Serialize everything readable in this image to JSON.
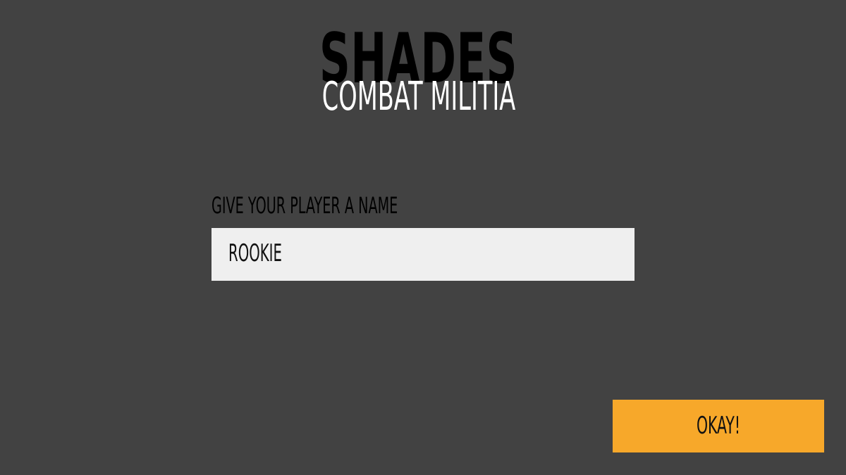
{
  "logo": {
    "title": "SHADES",
    "subtitle": "COMBAT MILITIA"
  },
  "name_form": {
    "label": "GIVE YOUR PLAYER A NAME",
    "value": "ROOKIE"
  },
  "actions": {
    "okay_label": "OKAY!"
  },
  "colors": {
    "background": "#424242",
    "input_background": "#efefef",
    "accent": "#f7a82a"
  }
}
